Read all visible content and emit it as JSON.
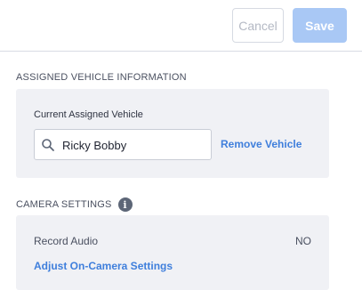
{
  "header": {
    "cancel_label": "Cancel",
    "save_label": "Save"
  },
  "vehicle_section": {
    "title": "ASSIGNED VEHICLE INFORMATION",
    "field_label": "Current Assigned Vehicle",
    "search_value": "Ricky Bobby",
    "remove_label": "Remove Vehicle"
  },
  "camera_section": {
    "title": "CAMERA SETTINGS",
    "info_glyph": "i",
    "record_audio_label": "Record Audio",
    "record_audio_value": "NO",
    "adjust_link_label": "Adjust On-Camera Settings"
  },
  "colors": {
    "accent": "#3f7fdc",
    "save_button_bg": "#a9c8f5",
    "panel_bg": "#f0f1f5"
  },
  "icons": {
    "search": "search-icon",
    "info": "info-icon"
  }
}
